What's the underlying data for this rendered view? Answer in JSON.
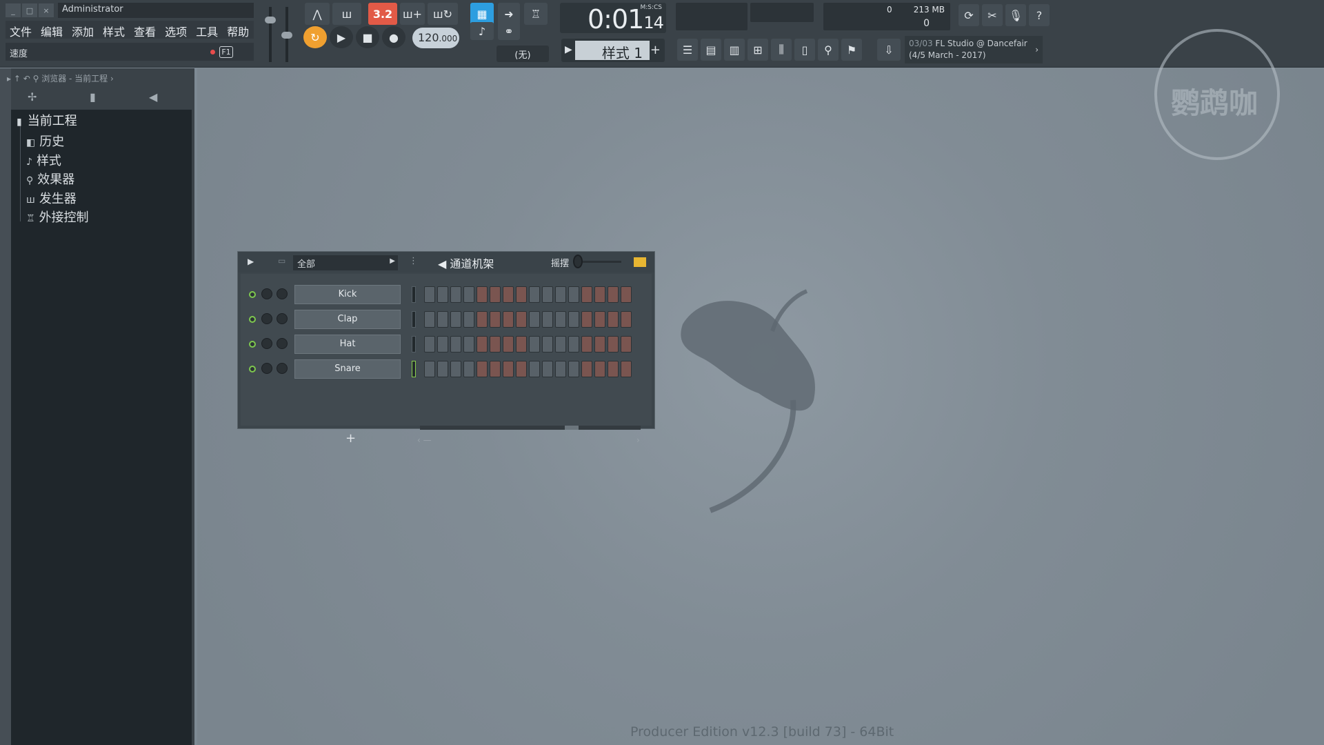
{
  "window": {
    "user": "Administrator",
    "controls": [
      "_",
      "□",
      "×"
    ]
  },
  "menu": [
    "文件",
    "编辑",
    "添加",
    "样式",
    "查看",
    "选项",
    "工具",
    "帮助"
  ],
  "hint": {
    "label": "速度",
    "key": "F1"
  },
  "transport": {
    "tempo": "120",
    "tempo_fraction": ".000",
    "pattern_song_label": "3.2",
    "time_label": "M:S:CS",
    "time_main": "0:01",
    "time_cs": "14",
    "pattern_label": "样式 1",
    "snap_label": "(无)"
  },
  "cpu": {
    "voices": "0",
    "memory": "213 MB",
    "polyphony": "0"
  },
  "news": {
    "counter": "03/03",
    "headline": "FL Studio @ Dancefair",
    "date": "(4/5 March - 2017)"
  },
  "browser": {
    "crumb": "浏览器 - 当前工程",
    "root": "当前工程",
    "items": [
      {
        "label": "历史",
        "icon": "history-icon"
      },
      {
        "label": "样式",
        "icon": "note-icon"
      },
      {
        "label": "效果器",
        "icon": "plug-icon"
      },
      {
        "label": "发生器",
        "icon": "generator-icon"
      },
      {
        "label": "外接控制",
        "icon": "remote-icon"
      }
    ]
  },
  "rack": {
    "filter": "全部",
    "title": "通道机架",
    "swing_label": "摇摆",
    "channels": [
      {
        "name": "Kick",
        "active_meter": false
      },
      {
        "name": "Clap",
        "active_meter": false
      },
      {
        "name": "Hat",
        "active_meter": false
      },
      {
        "name": "Snare",
        "active_meter": true
      }
    ],
    "add_label": "+"
  },
  "footer": {
    "edition": "Producer Edition v12.3 [build 73] - 64Bit"
  },
  "watermark": {
    "text": "鹦鹉咖"
  },
  "colors": {
    "accent_orange": "#f0a030",
    "accent_red": "#e25a47",
    "accent_blue": "#2d9ee0",
    "led_green": "#7ec94e"
  }
}
